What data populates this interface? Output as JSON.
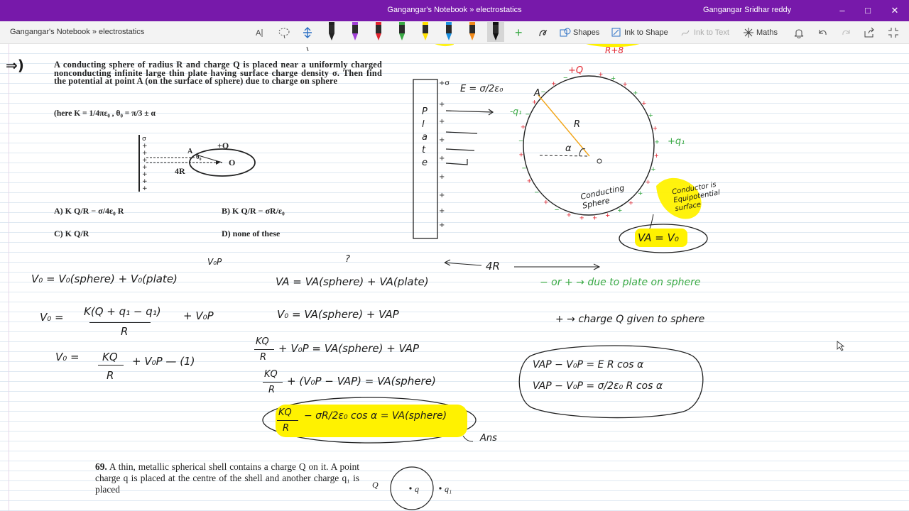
{
  "window": {
    "title": "Gangangar's Notebook » electrostatics",
    "user": "Gangangar Sridhar reddy"
  },
  "toolbar": {
    "notebook_label": "Gangangar's Notebook » electrostatics",
    "shapes_label": "Shapes",
    "ink_to_shape_label": "Ink to Shape",
    "ink_to_text_label": "Ink to Text",
    "maths_label": "Maths",
    "pens": [
      {
        "name": "black",
        "color": "#222222"
      },
      {
        "name": "purple",
        "color": "#a23fd8"
      },
      {
        "name": "red",
        "color": "#e0242e"
      },
      {
        "name": "green",
        "color": "#39a944"
      },
      {
        "name": "yellow",
        "color": "#ffe100"
      },
      {
        "name": "blue",
        "color": "#1a8fe0"
      },
      {
        "name": "orange",
        "color": "#f28a1a"
      },
      {
        "name": "black-selected",
        "color": "#111111"
      }
    ]
  },
  "problem": {
    "marker": "⇒)",
    "text": "A conducting sphere of radius R and charge Q is placed near a uniformly charged nonconducting infinite large thin plate having surface charge density σ. Then find the potential at point A (on the surface of sphere) due to charge on sphere",
    "condition": "(here K = 1/4πε₀ , θ₀ = π/3 ± α",
    "figure_plus_q": "+Q",
    "figure_dist": "4R",
    "figure_theta": "θ₀",
    "figure_a": "A",
    "figure_o": "O",
    "option_a": "A)  K Q/R − σ/4ε₀ R",
    "option_b": "B)  K Q/R − σR/ε₀",
    "option_c": "C)  K Q/R",
    "option_d": "D)  none of these"
  },
  "sketch": {
    "plate_letters": [
      "P",
      "l",
      "a",
      "t",
      "e"
    ],
    "e_field": "E = σ/2ε₀",
    "plus_q": "+Q",
    "label_a": "A",
    "label_r": "R",
    "label_alpha": "α",
    "label_o": "O",
    "minus_q1": "-q₁",
    "plus_q1": "+q₁",
    "conducting": "Conducting Sphere",
    "note": "Conductor is Equipotential surface",
    "va_eq": "VA = V₀",
    "distance": "4R",
    "top_note": "R+8"
  },
  "work": {
    "v0_line1": "V₀ = V₀(sphere) + V₀(plate)",
    "v0p": "V₀P",
    "v0_line2_num": "K(Q + q₁ − q₁)",
    "v0_line2_den": "R",
    "v0_line2_tail": "+ V₀P",
    "v0_line3_lhs": "V₀ =",
    "v0_line3_num": "KQ",
    "v0_line3_den": "R",
    "v0_line3_tail": "+ V₀P  — (1)",
    "va_line1": "VA = VA(sphere) + VA(plate)",
    "question_mark": "?",
    "va_line2": "V₀  = VA(sphere) + VAP",
    "va_line3_num": "KQ",
    "va_line3_den": "R",
    "va_line3_tail": "+ V₀P  = VA(sphere) + VAP",
    "va_line4_num": "KQ",
    "va_line4_den": "R",
    "va_line4_tail": "+ (V₀P − VAP) = VA(sphere)",
    "answer_num": "KQ",
    "answer_den": "R",
    "answer_mid": "− σR/2ε₀ cos α = VA(sphere)",
    "ans_label": "Ans",
    "legend_1": "− or +  → due to plate on sphere",
    "legend_2": "+  → charge Q given to sphere",
    "box_line1": "VAP − V₀P = E R cos α",
    "box_line2": "VAP − V₀P  = σ/2ε₀ R cos α"
  },
  "q69": {
    "number": "69.",
    "text": "A thin, metallic spherical shell contains a charge Q on it. A point charge q is placed at the centre of the shell and another charge q₁ is placed",
    "fig_q_outer": "Q",
    "fig_q": "q",
    "fig_q1": "q₁"
  }
}
